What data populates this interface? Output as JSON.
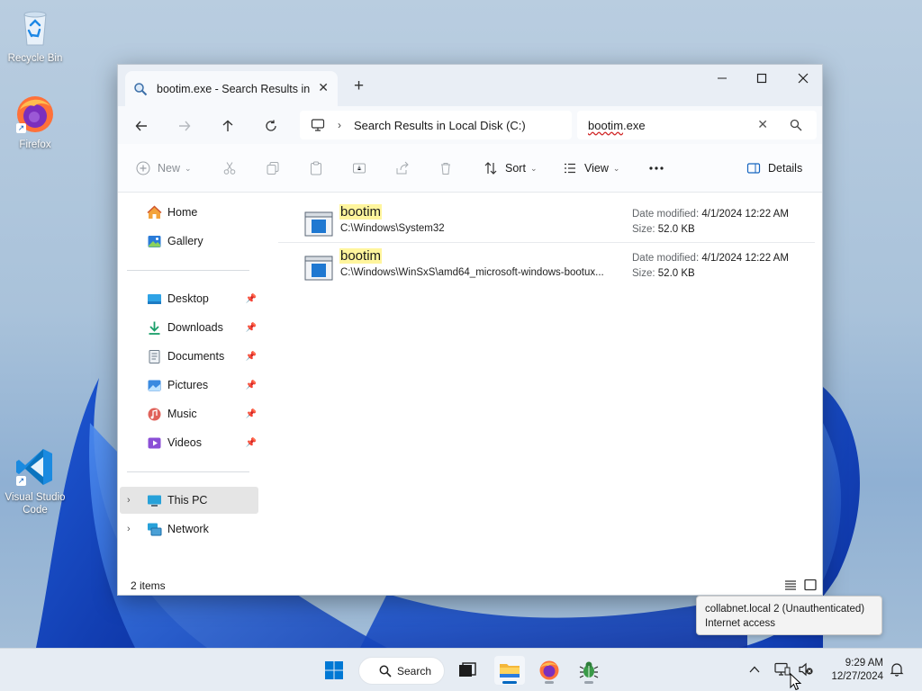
{
  "desktop": {
    "icons": [
      {
        "label": "Recycle Bin"
      },
      {
        "label": "Firefox"
      },
      {
        "label": "Visual Studio Code"
      }
    ]
  },
  "window": {
    "tab_title": "bootim.exe - Search Results in",
    "address_path": "Search Results in Local Disk (C:)",
    "search_query_part1": "bootim",
    "search_query_part2": ".exe",
    "toolbar": {
      "new_label": "New",
      "sort_label": "Sort",
      "view_label": "View",
      "details_label": "Details"
    },
    "sidebar": {
      "quick": [
        {
          "label": "Home",
          "icon": "home-icon"
        },
        {
          "label": "Gallery",
          "icon": "gallery-icon"
        }
      ],
      "pinned": [
        {
          "label": "Desktop",
          "icon": "desktop-folder-icon"
        },
        {
          "label": "Downloads",
          "icon": "downloads-folder-icon"
        },
        {
          "label": "Documents",
          "icon": "documents-folder-icon"
        },
        {
          "label": "Pictures",
          "icon": "pictures-folder-icon"
        },
        {
          "label": "Music",
          "icon": "music-folder-icon"
        },
        {
          "label": "Videos",
          "icon": "videos-folder-icon"
        }
      ],
      "locations": [
        {
          "label": "This PC",
          "icon": "this-pc-icon",
          "selected": true
        },
        {
          "label": "Network",
          "icon": "network-icon",
          "selected": false
        }
      ]
    },
    "results": [
      {
        "name": "bootim",
        "path": "C:\\Windows\\System32",
        "date_label": "Date modified:",
        "date": "4/1/2024 12:22 AM",
        "size_label": "Size:",
        "size": "52.0 KB"
      },
      {
        "name": "bootim",
        "path": "C:\\Windows\\WinSxS\\amd64_microsoft-windows-bootux...",
        "date_label": "Date modified:",
        "date": "4/1/2024 12:22 AM",
        "size_label": "Size:",
        "size": "52.0 KB"
      }
    ],
    "status": "2 items"
  },
  "tooltip": {
    "line1": "collabnet.local 2 (Unauthenticated)",
    "line2": "Internet access"
  },
  "taskbar": {
    "search_label": "Search",
    "time": "9:29 AM",
    "date": "12/27/2024"
  },
  "colors": {
    "accent": "#0067c0",
    "highlight": "#fff59d"
  }
}
